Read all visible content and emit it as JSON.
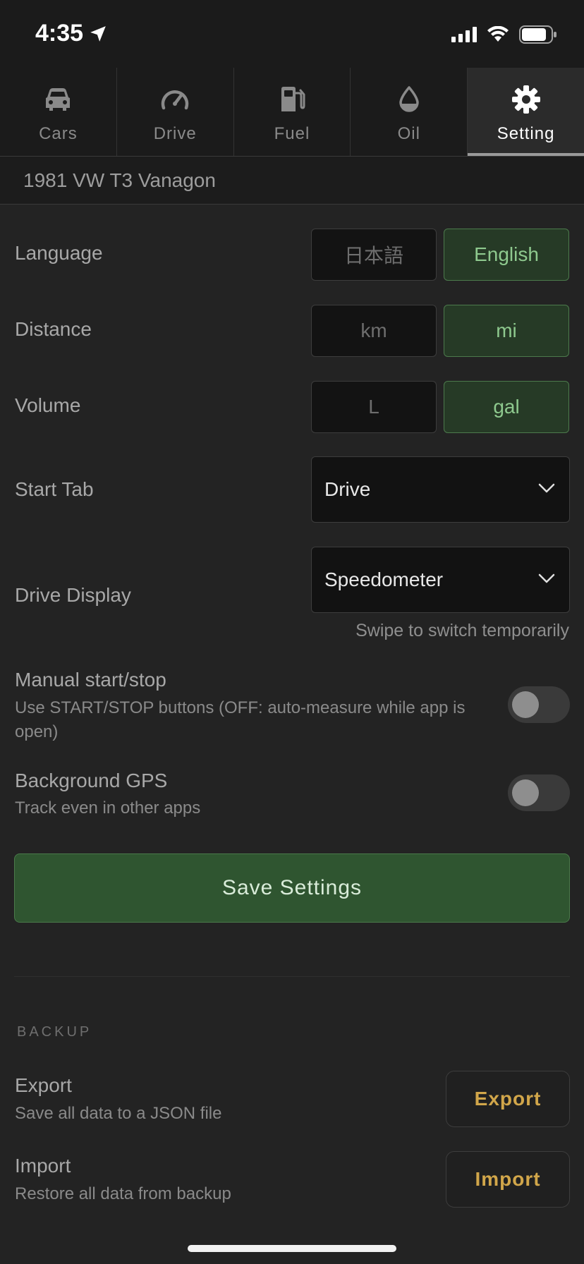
{
  "status": {
    "time": "4:35"
  },
  "tabs": [
    {
      "label": "Cars",
      "icon": "car-icon",
      "active": false
    },
    {
      "label": "Drive",
      "icon": "speedometer-icon",
      "active": false
    },
    {
      "label": "Fuel",
      "icon": "fuel-pump-icon",
      "active": false
    },
    {
      "label": "Oil",
      "icon": "oil-drop-icon",
      "active": false
    },
    {
      "label": "Setting",
      "icon": "gear-icon",
      "active": true
    }
  ],
  "car": {
    "name": "1981 VW T3 Vanagon"
  },
  "settings": {
    "language": {
      "label": "Language",
      "options": [
        "日本語",
        "English"
      ],
      "selected": "English"
    },
    "distance": {
      "label": "Distance",
      "options": [
        "km",
        "mi"
      ],
      "selected": "mi"
    },
    "volume": {
      "label": "Volume",
      "options": [
        "L",
        "gal"
      ],
      "selected": "gal"
    },
    "start_tab": {
      "label": "Start Tab",
      "value": "Drive"
    },
    "drive_display": {
      "label": "Drive Display",
      "value": "Speedometer",
      "hint": "Swipe to switch temporarily"
    },
    "manual_start_stop": {
      "title": "Manual start/stop",
      "subtitle": "Use START/STOP buttons (OFF: auto-measure while app is open)",
      "on": false
    },
    "background_gps": {
      "title": "Background GPS",
      "subtitle": "Track even in other apps",
      "on": false
    },
    "save_label": "Save Settings"
  },
  "backup": {
    "section_label": "BACKUP",
    "export": {
      "title": "Export",
      "subtitle": "Save all data to a JSON file",
      "button": "Export"
    },
    "import": {
      "title": "Import",
      "subtitle": "Restore all data from backup",
      "button": "Import"
    }
  },
  "colors": {
    "accent_green": "#8ec98e",
    "save_green": "#2f5530",
    "action_gold": "#d1a64a",
    "background": "#232323"
  }
}
